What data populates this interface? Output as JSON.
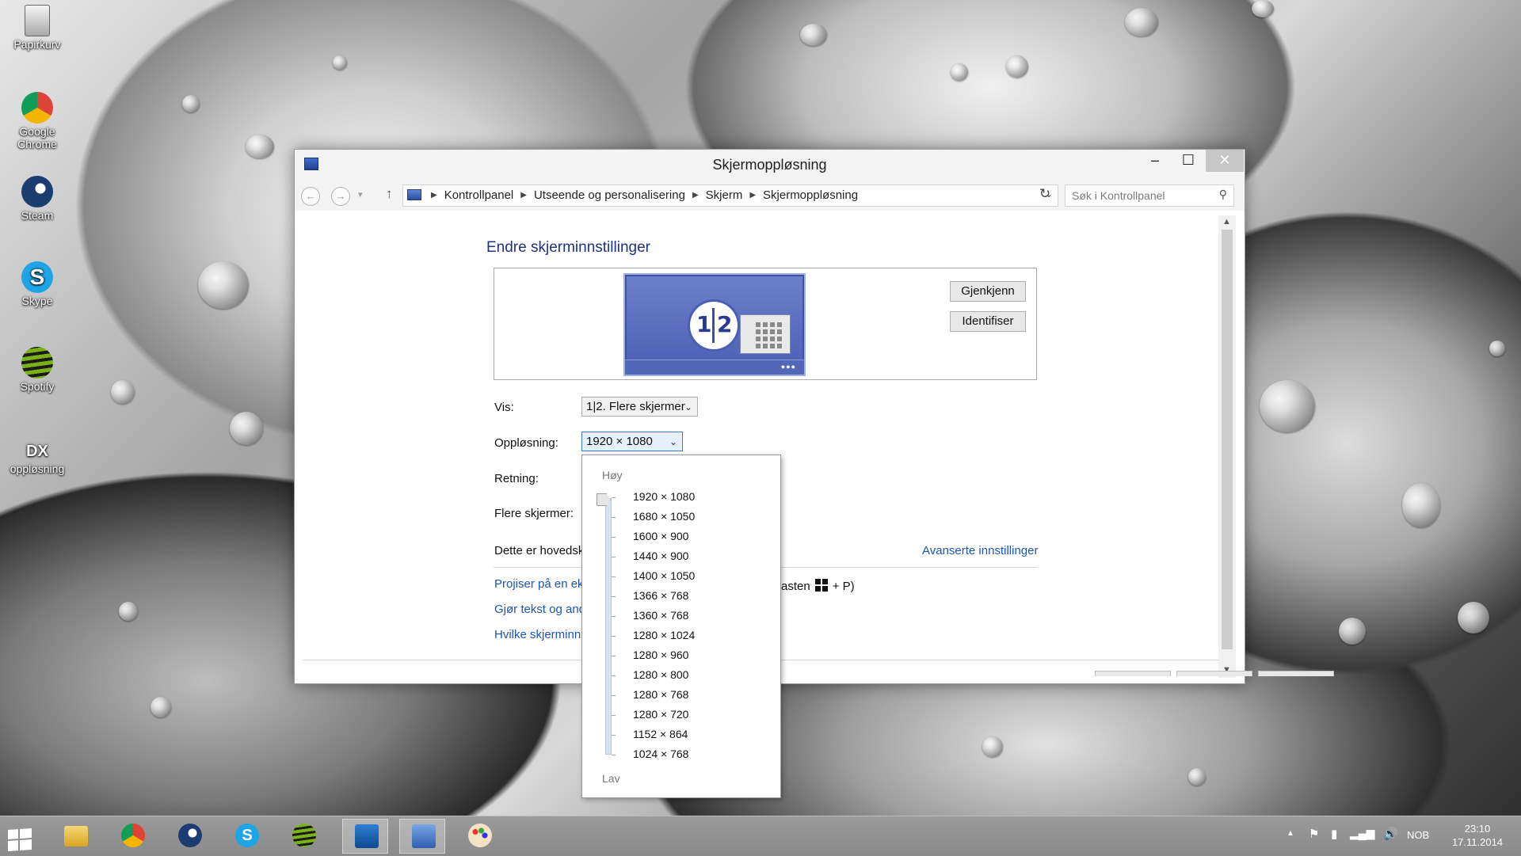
{
  "desktop": {
    "icons": [
      {
        "label": "Papirkurv",
        "icon": "recycle-bin-icon"
      },
      {
        "label": "Google Chrome",
        "icon": "chrome-icon"
      },
      {
        "label": "Steam",
        "icon": "steam-icon"
      },
      {
        "label": "Skype",
        "icon": "skype-icon"
      },
      {
        "label": "Spotify",
        "icon": "spotify-icon"
      },
      {
        "label": "oppløsning",
        "icon": "shortcut-icon"
      }
    ]
  },
  "window": {
    "title": "Skjermoppløsning",
    "breadcrumb": [
      "Kontrollpanel",
      "Utseende og personalisering",
      "Skjerm",
      "Skjermoppløsning"
    ],
    "search_placeholder": "Søk i Kontrollpanel",
    "heading": "Endre skjerminnstillinger",
    "monitor_labels": {
      "one": "1",
      "two": "2"
    },
    "buttons": {
      "detect": "Gjenkjenn",
      "identify": "Identifiser"
    },
    "fields": {
      "display_label": "Vis:",
      "display_value": "1|2. Flere skjermer",
      "resolution_label": "Oppløsning:",
      "resolution_value": "1920 × 1080",
      "orientation_label": "Retning:",
      "multiple_label": "Flere skjermer:"
    },
    "main_display_text": "Dette er hovedsk",
    "advanced_link": "Avanserte innstillinger",
    "links": {
      "project": "Projiser på en ek",
      "project_suffix_before": "asten",
      "project_suffix_after": "+ P)",
      "text_size": "Gjør tekst og and",
      "which_settings": "Hvilke skjerminns"
    }
  },
  "resolution_dropdown": {
    "high_label": "Høy",
    "low_label": "Lav",
    "selected": "1920 × 1080",
    "options": [
      "1920 × 1080",
      "1680 × 1050",
      "1600 × 900",
      "1440 × 900",
      "1400 × 1050",
      "1366 × 768",
      "1360 × 768",
      "1280 × 1024",
      "1280 × 960",
      "1280 × 800",
      "1280 × 768",
      "1280 × 720",
      "1152 × 864",
      "1024 × 768"
    ]
  },
  "taskbar": {
    "items": [
      "start-button",
      "file-explorer",
      "chrome",
      "steam",
      "skype",
      "spotify",
      "intel-graphics",
      "control-panel",
      "paint"
    ],
    "language": "NOB",
    "time": "23:10",
    "date": "17.11.2014"
  },
  "colors": {
    "heading": "#1e3287",
    "link": "#1a56b8",
    "monitor": "#5367b8"
  }
}
